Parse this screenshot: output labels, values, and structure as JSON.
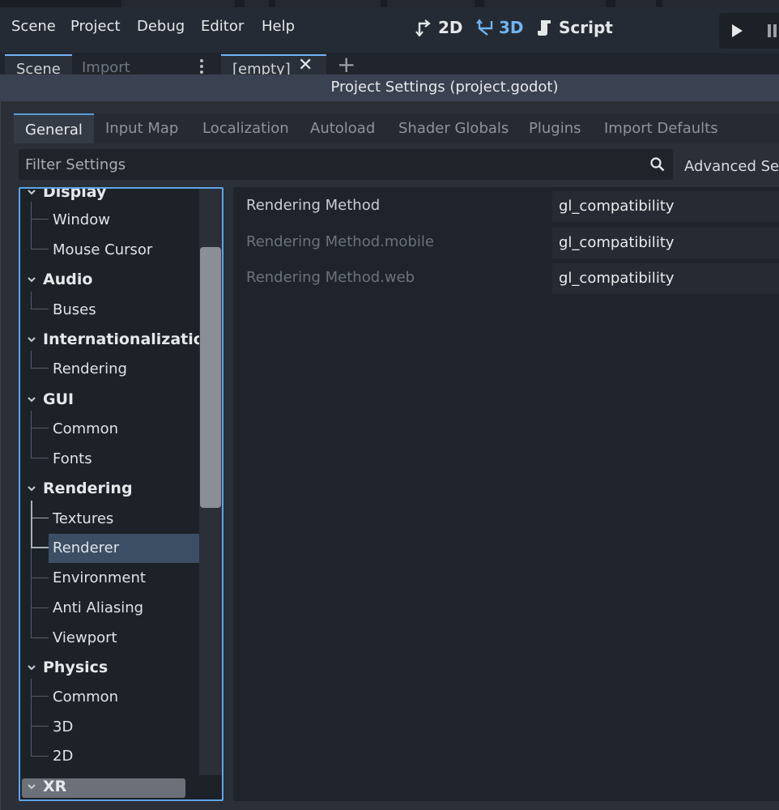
{
  "menubar": {
    "items": [
      "Scene",
      "Project",
      "Debug",
      "Editor",
      "Help"
    ],
    "modes": [
      {
        "label": "2D",
        "icon": "2d-viewport-icon"
      },
      {
        "label": "3D",
        "icon": "3d-viewport-icon",
        "active": true
      },
      {
        "label": "Script",
        "icon": "script-icon"
      }
    ],
    "run_icons": [
      "play-icon",
      "pause-icon"
    ]
  },
  "dock": {
    "tabs": [
      "Scene",
      "Import"
    ],
    "scene_tab": "[empty]",
    "icons": [
      "kebab-menu-icon",
      "close-icon",
      "add-tab-icon"
    ]
  },
  "dialog": {
    "title": "Project Settings (project.godot)",
    "tabs": [
      "General",
      "Input Map",
      "Localization",
      "Autoload",
      "Shader Globals",
      "Plugins",
      "Import Defaults"
    ],
    "active_tab": "General",
    "filter": {
      "placeholder": "Filter Settings",
      "value": ""
    },
    "advanced_label": "Advanced Set",
    "tree": {
      "sections": [
        "Display",
        "Audio",
        "Internationalization",
        "GUI",
        "Rendering",
        "Physics",
        "XR"
      ],
      "display_items": [
        "Window",
        "Mouse Cursor"
      ],
      "audio_items": [
        "Buses"
      ],
      "intl_items": [
        "Rendering"
      ],
      "gui_items": [
        "Common",
        "Fonts"
      ],
      "rendering_items": [
        "Textures",
        "Renderer",
        "Environment",
        "Anti Aliasing",
        "Viewport"
      ],
      "physics_items": [
        "Common",
        "3D",
        "2D"
      ],
      "selected": "Renderer"
    },
    "properties": [
      {
        "label": "Rendering Method",
        "value": "gl_compatibility"
      },
      {
        "label": "Rendering Method.mobile",
        "value": "gl_compatibility"
      },
      {
        "label": "Rendering Method.web",
        "value": "gl_compatibility"
      }
    ]
  },
  "colors": {
    "accent": "#70b4f4",
    "selection": "#3c4e63",
    "panel": "#2a2f38",
    "background": "#1d2229"
  }
}
